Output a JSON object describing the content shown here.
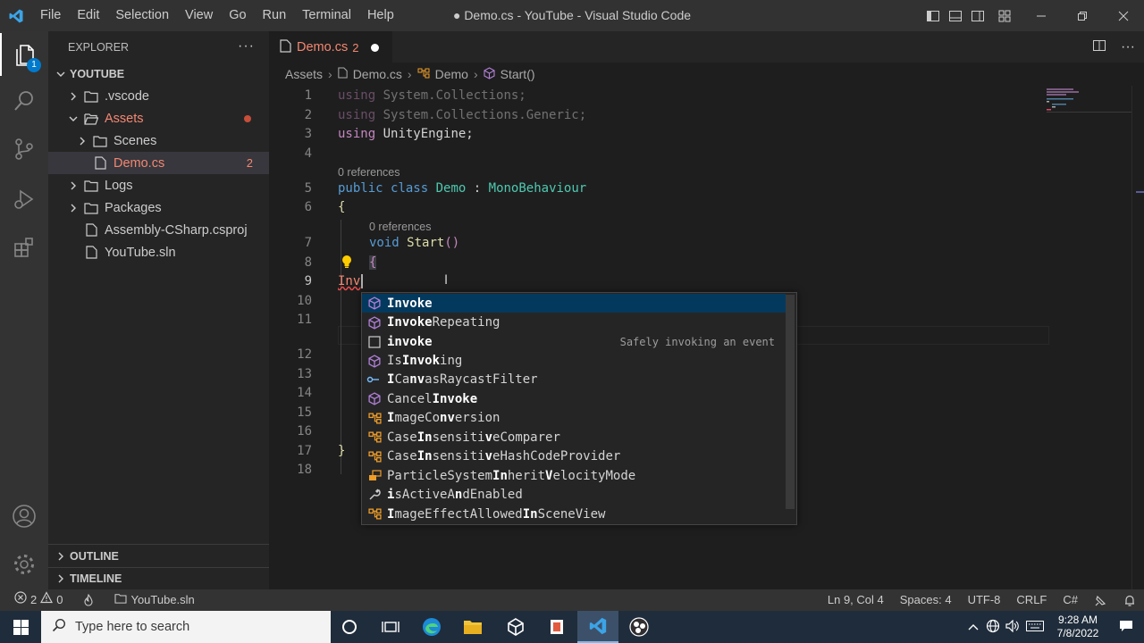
{
  "window": {
    "title": "● Demo.cs - YouTube - Visual Studio Code",
    "menu": [
      "File",
      "Edit",
      "Selection",
      "View",
      "Go",
      "Run",
      "Terminal",
      "Help"
    ]
  },
  "activity_bar": {
    "items": [
      "explorer-icon",
      "search-icon",
      "source-control-icon",
      "run-debug-icon",
      "extensions-icon"
    ],
    "explorer_badge": "1",
    "bottom": [
      "account-icon",
      "manage-gear-icon"
    ]
  },
  "sidebar": {
    "header": "EXPLORER",
    "more": "···",
    "root": "YOUTUBE",
    "tree": [
      {
        "label": ".vscode",
        "type": "folder",
        "collapsed": true
      },
      {
        "label": "Assets",
        "type": "folder",
        "expanded": true,
        "error": true
      },
      {
        "label": "Scenes",
        "type": "folder",
        "collapsed": true
      },
      {
        "label": "Demo.cs",
        "type": "file",
        "error_count": "2"
      },
      {
        "label": "Logs",
        "type": "folder",
        "collapsed": true
      },
      {
        "label": "Packages",
        "type": "folder",
        "collapsed": true
      },
      {
        "label": "Assembly-CSharp.csproj",
        "type": "file"
      },
      {
        "label": "YouTube.sln",
        "type": "file"
      }
    ],
    "outline": "OUTLINE",
    "timeline": "TIMELINE"
  },
  "editor": {
    "tab": {
      "name": "Demo.cs",
      "problems": "2"
    },
    "breadcrumbs": [
      "Assets",
      "Demo.cs",
      "Demo",
      "Start()"
    ],
    "code_lens": [
      "0 references",
      "0 references"
    ],
    "lines": {
      "l1": [
        "using",
        "System.Collections;"
      ],
      "l2": [
        "using",
        "System.Collections.Generic;"
      ],
      "l3": [
        "using",
        "UnityEngine;"
      ],
      "l5": [
        "public",
        "class",
        "Demo",
        ":",
        "MonoBehaviour"
      ],
      "l6": "{",
      "l7": [
        "void",
        "Start",
        "()"
      ],
      "l8": "{",
      "l9": "Inv",
      "l17": "}"
    },
    "line_numbers": [
      "1",
      "2",
      "3",
      "4",
      "5",
      "6",
      "7",
      "8",
      "9",
      "10",
      "11",
      "12",
      "13",
      "14",
      "15",
      "16",
      "17",
      "18"
    ],
    "current_line": 9
  },
  "suggestions": {
    "selected_index": 0,
    "detail": "Safely invoking an event",
    "items": [
      {
        "icon": "method-icon",
        "parts": [
          [
            "b",
            "Invoke"
          ]
        ]
      },
      {
        "icon": "method-icon",
        "parts": [
          [
            "b",
            "Invoke"
          ],
          [
            "n",
            "Repeating"
          ]
        ]
      },
      {
        "icon": "snippet-icon",
        "parts": [
          [
            "b",
            "invoke"
          ]
        ]
      },
      {
        "icon": "method-icon",
        "parts": [
          [
            "n",
            "Is"
          ],
          [
            "b",
            "Invok"
          ],
          [
            "n",
            "ing"
          ]
        ]
      },
      {
        "icon": "interface-icon",
        "parts": [
          [
            "b",
            "I"
          ],
          [
            "n",
            "Ca"
          ],
          [
            "b",
            "nv"
          ],
          [
            "n",
            "asRaycastFilter"
          ]
        ]
      },
      {
        "icon": "method-icon",
        "parts": [
          [
            "n",
            "Cancel"
          ],
          [
            "b",
            "Invoke"
          ]
        ]
      },
      {
        "icon": "class-icon",
        "parts": [
          [
            "b",
            "I"
          ],
          [
            "n",
            "mageCo"
          ],
          [
            "b",
            "nv"
          ],
          [
            "n",
            "ersion"
          ]
        ]
      },
      {
        "icon": "class-icon",
        "parts": [
          [
            "n",
            "Case"
          ],
          [
            "b",
            "In"
          ],
          [
            "n",
            "sensiti"
          ],
          [
            "b",
            "v"
          ],
          [
            "n",
            "eComparer"
          ]
        ]
      },
      {
        "icon": "class-icon",
        "parts": [
          [
            "n",
            "Case"
          ],
          [
            "b",
            "In"
          ],
          [
            "n",
            "sensiti"
          ],
          [
            "b",
            "v"
          ],
          [
            "n",
            "eHashCodeProvider"
          ]
        ]
      },
      {
        "icon": "enum-icon",
        "parts": [
          [
            "n",
            "ParticleSystem"
          ],
          [
            "b",
            "In"
          ],
          [
            "n",
            "herit"
          ],
          [
            "b",
            "V"
          ],
          [
            "n",
            "elocityMode"
          ]
        ]
      },
      {
        "icon": "property-icon",
        "parts": [
          [
            "b",
            "i"
          ],
          [
            "n",
            "sActiveA"
          ],
          [
            "b",
            "n"
          ],
          [
            "n",
            "dEnabled"
          ]
        ]
      },
      {
        "icon": "class-icon",
        "parts": [
          [
            "b",
            "I"
          ],
          [
            "n",
            "mageEffectAllowed"
          ],
          [
            "b",
            "In"
          ],
          [
            "n",
            "SceneView"
          ]
        ]
      }
    ]
  },
  "status_bar": {
    "errors": "2",
    "warnings": "0",
    "solution": "YouTube.sln",
    "position": "Ln 9, Col 4",
    "spaces": "Spaces: 4",
    "encoding": "UTF-8",
    "eol": "CRLF",
    "language": "C#"
  },
  "taskbar": {
    "search_placeholder": "Type here to search",
    "time": "9:28 AM",
    "date": "7/8/2022"
  },
  "colors": {
    "accent": "#007acc",
    "error": "#f48771",
    "keyword": "#569cd6",
    "control_keyword": "#c586c0",
    "type": "#4ec9b0",
    "function": "#dcdcaa"
  }
}
